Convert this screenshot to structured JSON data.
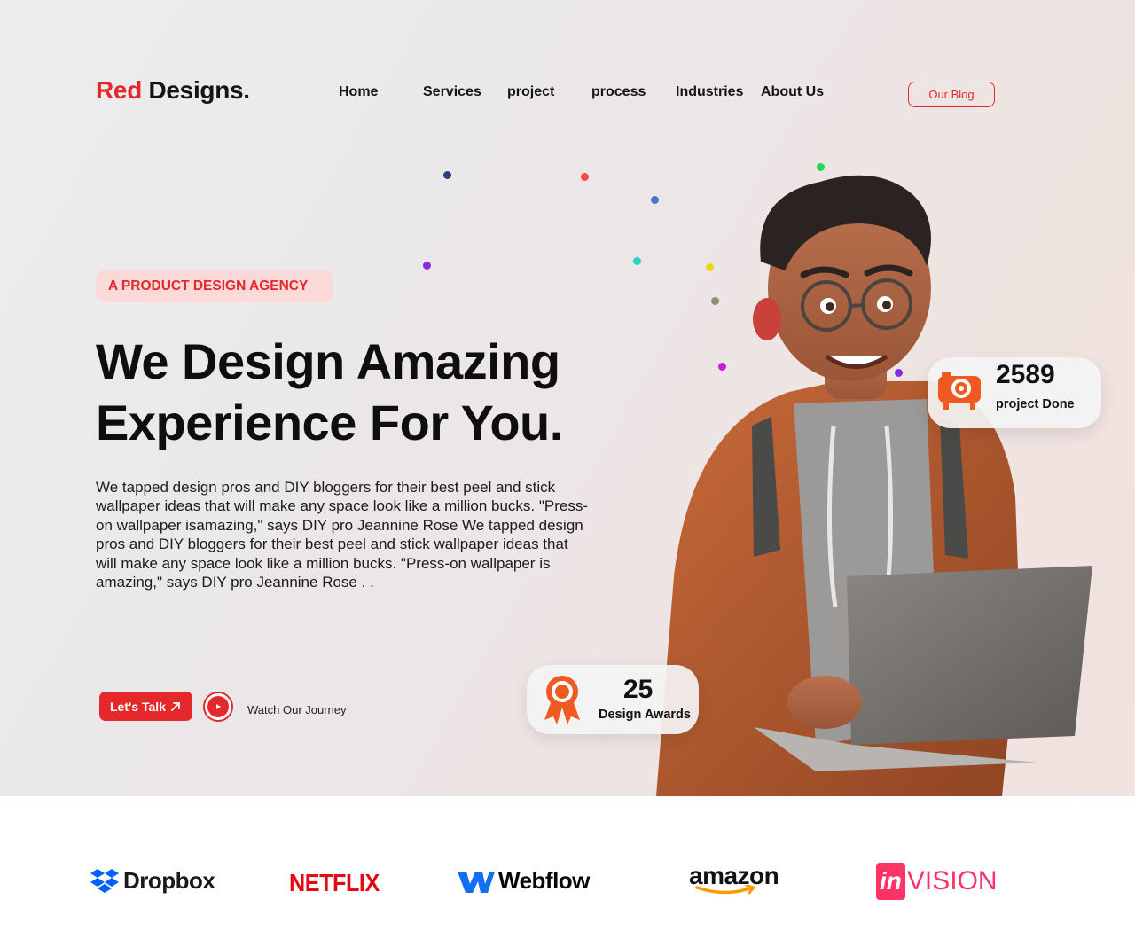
{
  "brand": {
    "name_red": "Red",
    "name_dark": "Designs."
  },
  "nav": {
    "links": [
      "Home",
      "Services",
      "project",
      "process",
      "Industries",
      "About Us"
    ],
    "blog_button": "Our Blog"
  },
  "hero": {
    "badge": "A PRODUCT DESIGN AGENCY",
    "headline_line1": "We Design Amazing",
    "headline_line2": "Experience For You.",
    "description": "We tapped design pros and DIY bloggers for their best peel and stick wallpaper ideas that will make any space look like a million bucks. \"Press-on wallpaper isamazing,\" says DIY pro Jeannine Rose We tapped design pros and DIY bloggers for their best peel and stick wallpaper ideas that will make any space look like a million bucks. \"Press-on wallpaper is amazing,\" says DIY pro Jeannine Rose . .",
    "cta_label": "Let's Talk",
    "cta_icon": "arrow-up-right-icon",
    "watch_label": "Watch Our Journey",
    "play_icon": "play-icon"
  },
  "stats": {
    "projects": {
      "value": "2589",
      "label": "project Done",
      "icon": "camera-icon"
    },
    "awards": {
      "value": "25",
      "label": "Design Awards",
      "icon": "award-ribbon-icon"
    }
  },
  "brands": [
    "Dropbox",
    "NETFLIX",
    "Webflow",
    "amazon",
    "invision"
  ],
  "colors": {
    "accent": "#e4282b",
    "orange": "#f05a22",
    "badge_bg": "#fbd9d9",
    "dropbox": "#0061fe",
    "netflix": "#e50914",
    "webflow": "#146ef5",
    "invision": "#ff3366"
  }
}
